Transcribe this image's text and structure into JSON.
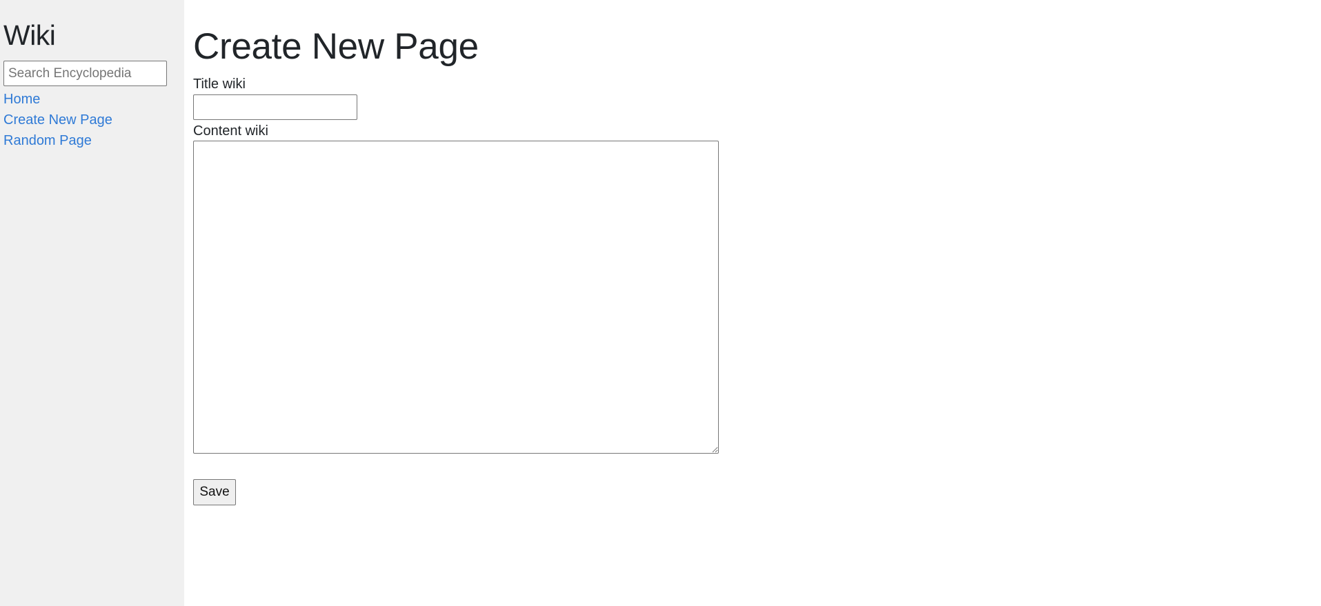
{
  "sidebar": {
    "heading": "Wiki",
    "search": {
      "placeholder": "Search Encyclopedia",
      "value": ""
    },
    "links": [
      {
        "label": "Home"
      },
      {
        "label": "Create New Page"
      },
      {
        "label": "Random Page"
      }
    ]
  },
  "main": {
    "title": "Create New Page",
    "form": {
      "title_label": "Title wiki",
      "title_value": "",
      "content_label": "Content wiki",
      "content_value": "",
      "save_label": "Save"
    }
  },
  "colors": {
    "sidebar_bg": "#f0f0f0",
    "link": "#2f7ad6",
    "text": "#212529"
  }
}
